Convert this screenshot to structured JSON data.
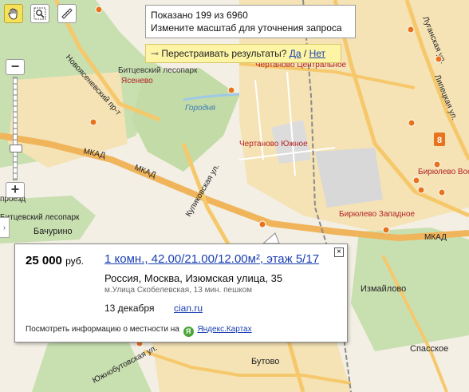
{
  "count_box": {
    "shown": "Показано 199 из 6960",
    "hint": "Измените масштаб для уточнения запроса"
  },
  "rearrange": {
    "question": "Перестраивать результаты?",
    "yes": "Да",
    "separator": "/",
    "no": "Нет"
  },
  "toolbar": {
    "hand": "hand-icon",
    "zoom_box": "zoom-box-icon",
    "ruler": "ruler-icon"
  },
  "zoom": {
    "plus": "+",
    "minus": "−"
  },
  "sidetab": {
    "label": "›"
  },
  "map_labels": {
    "bitsa_park": "Битцевский лесопарк",
    "yasenevo": "Ясенево",
    "novoyasenevsky": "Новоясеневский пр-т",
    "gorodnya": "Городня",
    "chertanovo_central": "Чертаново Центральное",
    "chertanovo_south": "Чертаново Южное",
    "mkad": "МКАД",
    "kulikovskaya": "Куликовская ул.",
    "proezd": "проезд",
    "bitsa_park2": "Битцевский лесопарк",
    "lugandskaya": "Луганская ул.",
    "lipetskaya": "Липецкая ул.",
    "biryulevo_vost": "Бирюлево Вос",
    "biryulevo_zap": "Бирюлево Западное",
    "bachurino": "Бачурино",
    "izmaylovo": "Измайлово",
    "spasskoe": "Спасское",
    "butovo": "Бутово",
    "yuzhnobutovskaya": "Южнобутовская ул.",
    "cluster": "8"
  },
  "popup": {
    "price": "25 000",
    "currency": "руб.",
    "title": "1 комн., 42.00/21.00/12.00м², этаж 5/17",
    "address": "Россия, Москва, Изюмская улица, 35",
    "metro": "м.Улица Скобелевская, 13 мин. пешком",
    "date": "13 декабря",
    "source": "cian.ru",
    "footer": "Посмотреть информацию о местности на",
    "footer_link": "Яндекс.Картах",
    "close": "×"
  }
}
